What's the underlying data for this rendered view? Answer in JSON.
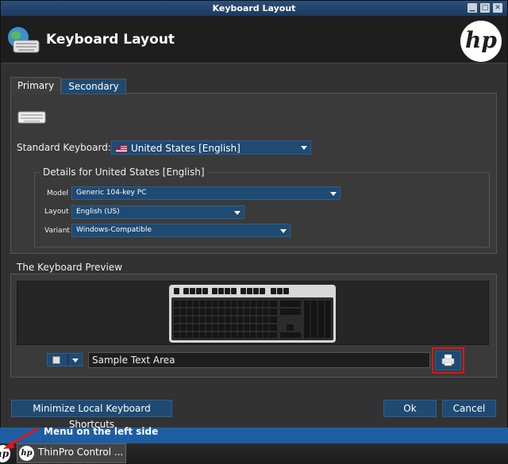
{
  "window": {
    "title": "Keyboard Layout"
  },
  "header": {
    "title": "Keyboard Layout",
    "logo_text": "hp"
  },
  "tabs": [
    {
      "label": "Primary"
    },
    {
      "label": "Secondary"
    }
  ],
  "standard_keyboard": {
    "label": "Standard Keyboard:",
    "value": "United States [English]"
  },
  "details": {
    "title": "Details for United States [English]",
    "model": {
      "label": "Model",
      "value": "Generic 104-key PC"
    },
    "layout": {
      "label": "Layout",
      "value": "English (US)"
    },
    "variant": {
      "label": "Variant",
      "value": "Windows-Compatible"
    }
  },
  "preview": {
    "title": "The Keyboard Preview",
    "sample_text": "Sample Text Area"
  },
  "buttons": {
    "minimize": "Minimize Local Keyboard Shortcuts",
    "ok": "Ok",
    "cancel": "Cancel"
  },
  "background_text": "Menu on the left side",
  "taskbar": {
    "item_label": "ThinPro Control ...",
    "logo_text": "hp"
  },
  "colors": {
    "accent": "#1f4a72",
    "highlight": "#e01515",
    "titlebar": "#2d4f78"
  }
}
